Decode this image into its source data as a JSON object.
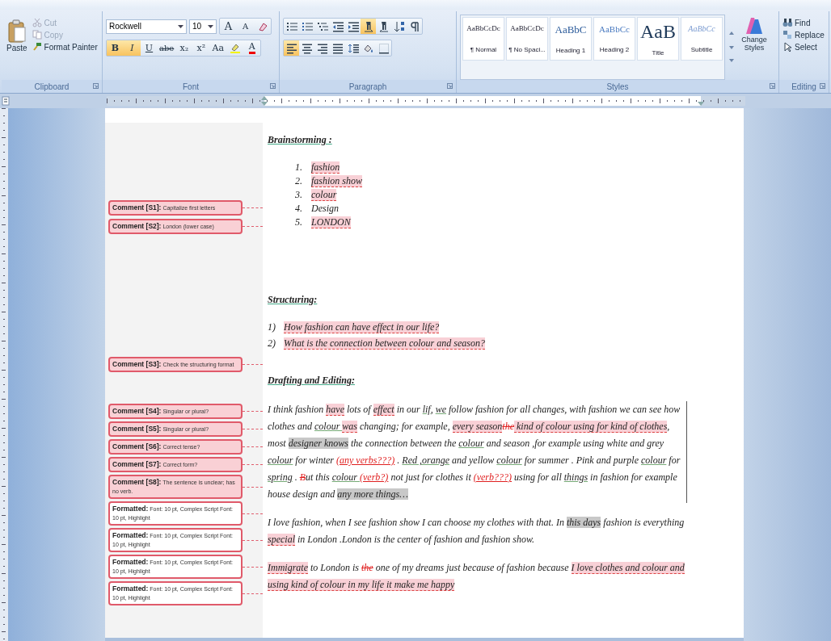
{
  "ribbon": {
    "clipboard": {
      "paste": "Paste",
      "cut": "Cut",
      "copy": "Copy",
      "format_painter": "Format Painter",
      "label": "Clipboard"
    },
    "font": {
      "name": "Rockwell",
      "size": "10",
      "top_buttons": [
        {
          "kind": "grow",
          "label": "A"
        },
        {
          "kind": "shrink",
          "label": "A"
        },
        {
          "kind": "clear"
        }
      ],
      "bottom_buttons": [
        {
          "kind": "bold",
          "label": "B",
          "selected": true
        },
        {
          "kind": "italic",
          "label": "I",
          "selected": true
        },
        {
          "kind": "underline",
          "label": "U",
          "selected": false
        },
        {
          "kind": "strike",
          "label": "abe",
          "selected": false
        },
        {
          "kind": "sub",
          "label": "x₂",
          "selected": false
        },
        {
          "kind": "sup",
          "label": "x²",
          "selected": false
        },
        {
          "kind": "case",
          "label": "Aa",
          "selected": false
        },
        {
          "kind": "highlight",
          "selected": false
        },
        {
          "kind": "color",
          "label": "A",
          "selected": false
        }
      ],
      "label": "Font"
    },
    "paragraph": {
      "top_tools": [
        {
          "kind": "bullets",
          "selected": false
        },
        {
          "kind": "numbering",
          "selected": false
        },
        {
          "kind": "multilevel",
          "selected": false
        },
        {
          "kind": "outdent",
          "selected": false
        },
        {
          "kind": "indent",
          "selected": false
        },
        {
          "kind": "ltr",
          "selected": true
        },
        {
          "kind": "rtl",
          "selected": false
        },
        {
          "kind": "sort",
          "selected": false
        },
        {
          "kind": "marks",
          "selected": false
        }
      ],
      "bottom_tools": [
        {
          "kind": "left",
          "selected": true
        },
        {
          "kind": "center",
          "selected": false
        },
        {
          "kind": "right",
          "selected": false
        },
        {
          "kind": "justify",
          "selected": false
        },
        {
          "kind": "spacing",
          "selected": false
        },
        {
          "kind": "shading",
          "selected": false
        },
        {
          "kind": "borders",
          "selected": false
        }
      ],
      "label": "Paragraph"
    },
    "styles": {
      "items": [
        {
          "kind": "normal",
          "preview": "AaBbCcDc",
          "name": "¶ Normal"
        },
        {
          "kind": "nospacing",
          "preview": "AaBbCcDc",
          "name": "¶ No Spaci..."
        },
        {
          "kind": "heading1",
          "preview": "AaBbC",
          "name": "Heading 1"
        },
        {
          "kind": "heading2",
          "preview": "AaBbCc",
          "name": "Heading 2"
        },
        {
          "kind": "title",
          "preview": "AaB",
          "name": "Title"
        },
        {
          "kind": "subtitle",
          "preview": "AaBbCc",
          "name": "Subtitle"
        }
      ],
      "change": "Change Styles",
      "label": "Styles"
    },
    "editing": {
      "items": [
        {
          "kind": "find",
          "label": "Find"
        },
        {
          "kind": "replace",
          "label": "Replace"
        },
        {
          "kind": "select",
          "label": "Select"
        }
      ],
      "label": "Editing"
    }
  },
  "document": {
    "sections": [
      {
        "comments": [
          {
            "kind": "comment",
            "label": "Comment [S1]:",
            "text": "Capitalize first letters"
          },
          {
            "kind": "comment",
            "label": "Comment [S2]:",
            "text": "London (lower case)"
          }
        ],
        "blocks": [
          {
            "kind": "heading",
            "text": "Brainstorming :"
          },
          {
            "kind": "numbered",
            "items": [
              {
                "number": "1.",
                "text": "fashion",
                "kind": "comment"
              },
              {
                "number": "2.",
                "text": "fashion show",
                "kind": "comment"
              },
              {
                "number": "3.",
                "text": "colour",
                "kind": "comment"
              },
              {
                "number": "4.",
                "text": "Design",
                "kind": "plain"
              },
              {
                "number": "5.",
                "text": "LONDON",
                "kind": "comment"
              }
            ]
          }
        ]
      },
      {
        "comments": [
          {
            "kind": "comment",
            "label": "Comment [S3]:",
            "text": "Check the structuring format"
          }
        ],
        "blocks": [
          {
            "kind": "heading",
            "text": "Structuring:"
          },
          {
            "kind": "numbered",
            "items": [
              {
                "number": "1)",
                "text": "How fashion can have effect in our life?",
                "kind": "comment"
              },
              {
                "number": "2)",
                "text": "What is the connection between colour and season?",
                "kind": "comment"
              }
            ]
          }
        ]
      },
      {
        "comments": [
          {
            "kind": "comment",
            "label": "Comment [S4]:",
            "text": "Singular or plural?"
          },
          {
            "kind": "comment",
            "label": "Comment [S5]:",
            "text": "Singular or plural?"
          },
          {
            "kind": "comment",
            "label": "Comment [S6]:",
            "text": "Correct tense?"
          },
          {
            "kind": "comment",
            "label": "Comment [S7]:",
            "text": "Correct form?"
          },
          {
            "kind": "comment",
            "label": "Comment [S8]:",
            "text": "The sentence is unclear; has no verb."
          },
          {
            "kind": "format",
            "label": "Formatted:",
            "text": "Font: 10 pt, Complex Script Font: 10 pt, Highlight"
          },
          {
            "kind": "format",
            "label": "Formatted:",
            "text": "Font: 10 pt, Complex Script Font: 10 pt, Highlight"
          },
          {
            "kind": "format",
            "label": "Formatted:",
            "text": "Font: 10 pt, Complex Script Font: 10 pt, Highlight"
          },
          {
            "kind": "format",
            "label": "Formatted:",
            "text": "Font: 10 pt, Complex Script Font: 10 pt, Highlight"
          }
        ],
        "blocks": [
          {
            "kind": "heading",
            "text": "Drafting and Editing:"
          },
          {
            "kind": "paragraph",
            "segments": [
              {
                "text": "I think fashion ",
                "kind": "plain"
              },
              {
                "text": "have",
                "kind": "comment"
              },
              {
                "text": " lots of ",
                "kind": "plain"
              },
              {
                "text": "effect",
                "kind": "comment"
              },
              {
                "text": " in our ",
                "kind": "plain"
              },
              {
                "text": "lif",
                "kind": "spell"
              },
              {
                "text": ", ",
                "kind": "plain"
              },
              {
                "text": "we",
                "kind": "spell"
              },
              {
                "text": " follow fashion for all changes, with fashion we can see how clothes and ",
                "kind": "plain"
              },
              {
                "text": "colour ",
                "kind": "spell"
              },
              {
                "text": "was",
                "kind": "comment"
              },
              {
                "text": " changing; for example, ",
                "kind": "plain"
              },
              {
                "text": "every season",
                "kind": "comment"
              },
              {
                "text": "the",
                "kind": "deleted"
              },
              {
                "text": " kind of colour using for kind of clothes",
                "kind": "comment"
              },
              {
                "text": ", most ",
                "kind": "plain"
              },
              {
                "text": "designer knows",
                "kind": "gray"
              },
              {
                "text": " the connection between the ",
                "kind": "plain"
              },
              {
                "text": "colour",
                "kind": "spell"
              },
              {
                "text": " and season ,for example using white and grey ",
                "kind": "plain"
              },
              {
                "text": "colour",
                "kind": "spell"
              },
              {
                "text": " for winter ",
                "kind": "plain"
              },
              {
                "text": "(any verbs???)",
                "kind": "inserted"
              },
              {
                "text": " . ",
                "kind": "plain"
              },
              {
                "text": "Red ,orange",
                "kind": "spell"
              },
              {
                "text": " and yellow ",
                "kind": "plain"
              },
              {
                "text": "colour",
                "kind": "spell"
              },
              {
                "text": " for summer . Pink and purple ",
                "kind": "plain"
              },
              {
                "text": "colour",
                "kind": "spell"
              },
              {
                "text": " for ",
                "kind": "plain"
              },
              {
                "text": "spring",
                "kind": "spell"
              },
              {
                "text": " . ",
                "kind": "plain"
              },
              {
                "text": "B",
                "kind": "deleted"
              },
              {
                "text": "ut this ",
                "kind": "plain"
              },
              {
                "text": "colour ",
                "kind": "spell"
              },
              {
                "text": "(verb?)",
                "kind": "inserted"
              },
              {
                "text": " not just for clothes it ",
                "kind": "plain"
              },
              {
                "text": "(verb???)",
                "kind": "inserted"
              },
              {
                "text": " using for all ",
                "kind": "plain"
              },
              {
                "text": "things",
                "kind": "spell"
              },
              {
                "text": " in fashion for example house design and ",
                "kind": "plain"
              },
              {
                "text": "any more things…",
                "kind": "gray"
              }
            ]
          },
          {
            "kind": "paragraph",
            "segments": [
              {
                "text": "I love fashion, when I see fashion show I can choose my clothes with that. In ",
                "kind": "plain"
              },
              {
                "text": "this days",
                "kind": "gray"
              },
              {
                "text": " fashion is everything ",
                "kind": "plain"
              },
              {
                "text": "special",
                "kind": "comment"
              },
              {
                "text": " in London .London is the center of fashion and fashion show.",
                "kind": "plain"
              }
            ]
          },
          {
            "kind": "paragraph",
            "segments": [
              {
                "text": "Immigrate",
                "kind": "comment"
              },
              {
                "text": " to London is ",
                "kind": "plain"
              },
              {
                "text": "the",
                "kind": "deleted"
              },
              {
                "text": " one of my dreams just because of fashion because ",
                "kind": "plain"
              },
              {
                "text": "I love clothes and colour and using kind of colour in my life it make me happy",
                "kind": "comment"
              }
            ]
          }
        ]
      }
    ]
  }
}
